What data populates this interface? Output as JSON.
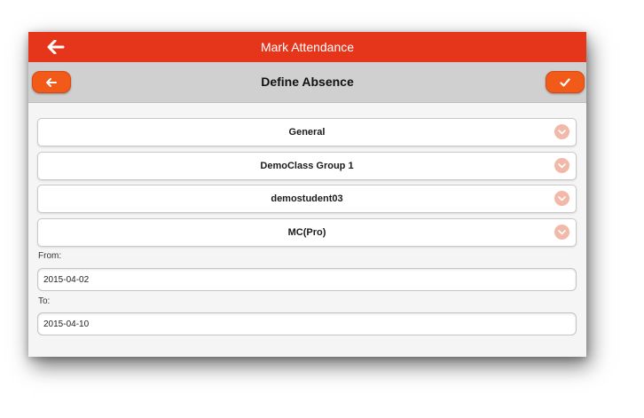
{
  "header": {
    "title": "Mark Attendance",
    "back_icon": "arrow-left-icon",
    "color": "#e5361b"
  },
  "subheader": {
    "title": "Define Absence",
    "back_icon": "arrow-left-icon",
    "confirm_icon": "checkmark-icon",
    "button_color": "#f25a1a"
  },
  "selects": [
    {
      "value": "General",
      "icon": "chevron-down-icon"
    },
    {
      "value": "DemoClass Group 1",
      "icon": "chevron-down-icon"
    },
    {
      "value": "demostudent03",
      "icon": "chevron-down-icon"
    },
    {
      "value": "MC(Pro)",
      "icon": "chevron-down-icon"
    }
  ],
  "from": {
    "label": "From:",
    "value": "2015-04-02"
  },
  "to": {
    "label": "To:",
    "value": "2015-04-10"
  }
}
